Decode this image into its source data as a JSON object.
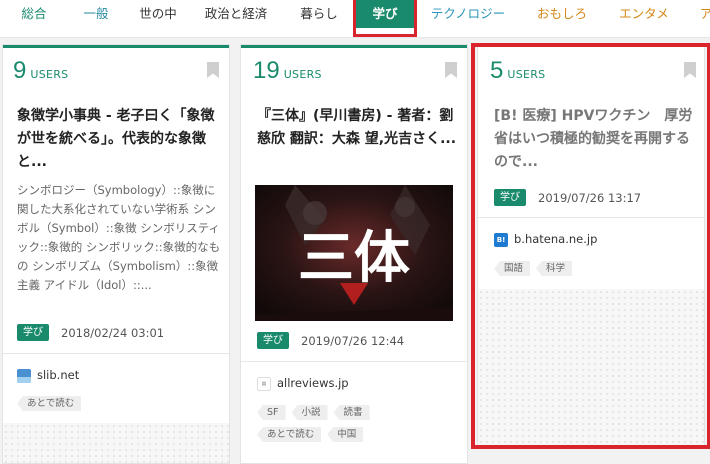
{
  "nav": {
    "items": [
      {
        "label": "総合",
        "active": false
      },
      {
        "label": "一般",
        "active": false
      },
      {
        "label": "世の中",
        "active": false
      },
      {
        "label": "政治と経済",
        "active": false
      },
      {
        "label": "暮らし",
        "active": false
      },
      {
        "label": "学び",
        "active": true
      },
      {
        "label": "テクノロジー",
        "active": false
      },
      {
        "label": "おもしろ",
        "active": false
      },
      {
        "label": "エンタメ",
        "active": false
      },
      {
        "label": "ア",
        "active": false
      }
    ],
    "colors": {
      "総合": "#1a8a6d",
      "一般": "#2a8aa0",
      "世の中": "#333333",
      "政治と経済": "#333333",
      "暮らし": "#333333",
      "テクノロジー": "#2a95b8",
      "おもしろ": "#d5891a",
      "エンタメ": "#d5891a",
      "ア": "#d5891a"
    }
  },
  "cards": [
    {
      "users_count": "9",
      "users_label": "USERS",
      "title": "象徴学小事典 - 老子曰く「象徴が世を統べる」。代表的な象徴と...",
      "summary": "シンボロジー（Symbology）::象徴に関した大系化されていない学術系 シンボル（Symbol）::象徴 シンボリスティック::象徴的 シンボリック::象徴的なもの シンボリズム（Symbolism）::象徴主義 アイドル（Idol）::...",
      "category": "学び",
      "date": "2018/02/24 03:01",
      "domain": "slib.net",
      "tags": [
        "あとで読む"
      ]
    },
    {
      "users_count": "19",
      "users_label": "USERS",
      "title": "『三体』(早川書房) - 著者：劉 慈欣 翻訳：大森 望,光吉さく...",
      "thumbnail_text": "三体",
      "category": "学び",
      "date": "2019/07/26 12:44",
      "domain": "allreviews.jp",
      "tags": [
        "SF",
        "小説",
        "読書",
        "あとで読む",
        "中国"
      ]
    },
    {
      "users_count": "5",
      "users_label": "USERS",
      "title": "[B! 医療] HPVワクチン　厚労省はいつ積極的勧奨を再開するので...",
      "category": "学び",
      "date": "2019/07/26 13:17",
      "domain": "b.hatena.ne.jp",
      "favicon_text": "B!",
      "tags": [
        "国語",
        "科学"
      ]
    }
  ],
  "theme": {
    "accent": "#1a8a6d",
    "highlight": "#d9232d"
  }
}
